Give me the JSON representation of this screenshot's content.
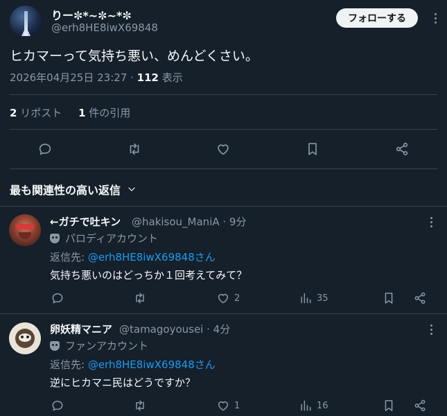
{
  "tweet": {
    "author_name": "りー✼*~✼~*✼",
    "author_handle": "@erh8HE8iwX69848",
    "follow_label": "フォローする",
    "text": "ヒカマーって気持ち悪い、めんどくさい。",
    "timestamp": "2026年04月25日 23:27 ·",
    "views_count": "112",
    "views_label": "表示",
    "reposts_count": "2",
    "reposts_label": "リポスト",
    "quotes_count": "1",
    "quotes_label": "件の引用"
  },
  "sort": {
    "label": "最も関連性の高い返信"
  },
  "replies": [
    {
      "name": "←ガチで吐キン",
      "handle": "@hakisou_ManiA · 9分",
      "account_label": "パロディアカウント",
      "reply_prefix": "返信先: ",
      "reply_to": "@erh8HE8iwX69848さん",
      "text": "気持ち悪いのはどっちか１回考えてみて？",
      "likes": "2",
      "views": "35"
    },
    {
      "name": "卵妖精マニア",
      "handle": "@tamagoyousei · 4分",
      "account_label": "ファンアカウント",
      "reply_prefix": "返信先: ",
      "reply_to": "@erh8HE8iwX69848さん",
      "text": "逆にヒカマニ民はどうですか？",
      "likes": "1",
      "views": "16"
    }
  ],
  "colors": {
    "background": "#15202b",
    "link": "#1d9bf0",
    "muted": "#8b98a5",
    "divider": "#38444d"
  },
  "icons": [
    "reply-icon",
    "repost-icon",
    "like-icon",
    "bookmark-icon",
    "share-icon",
    "views-icon",
    "more-icon",
    "chevron-down-icon",
    "mask-icon"
  ]
}
